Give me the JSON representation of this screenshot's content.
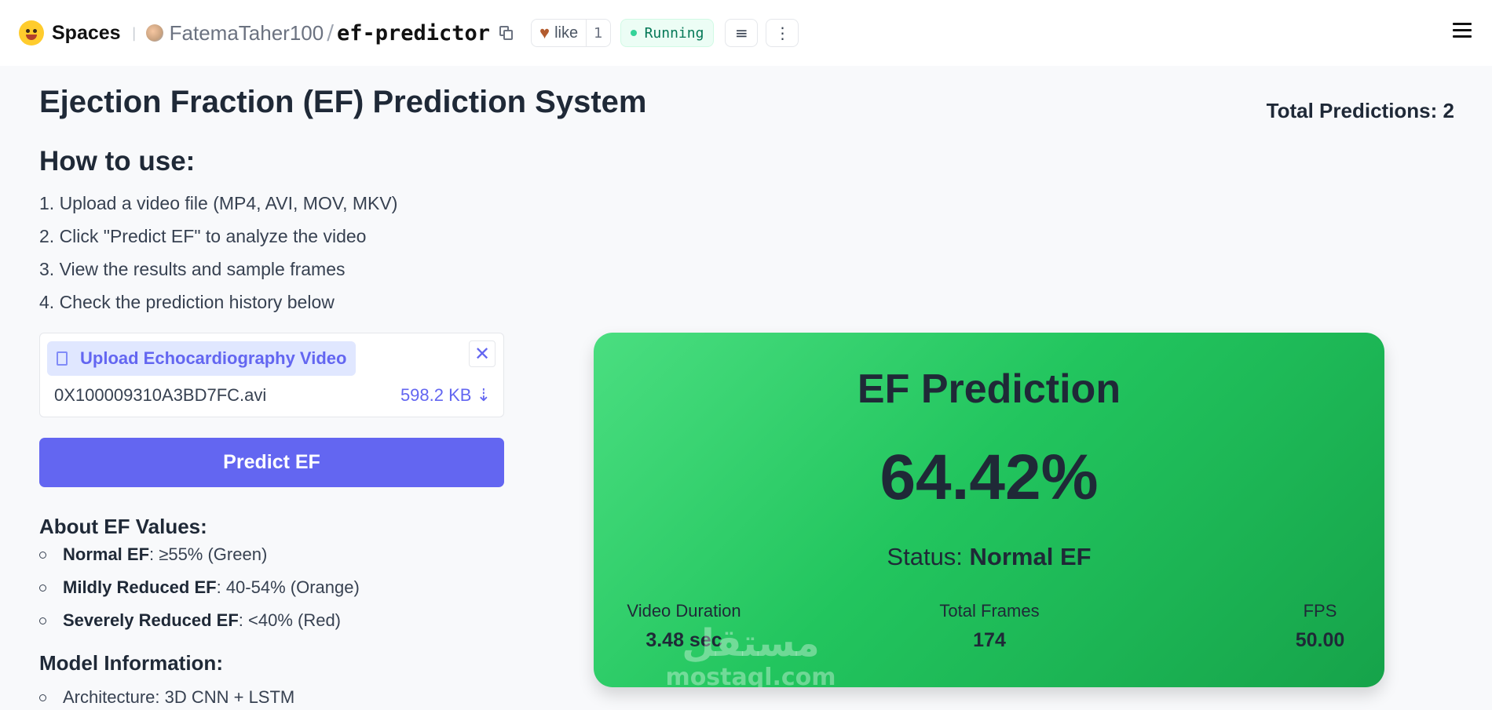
{
  "topbar": {
    "spaces_label": "Spaces",
    "owner": "FatemaTaher100",
    "separator": "/",
    "repo": "ef-predictor",
    "like_label": "like",
    "like_count": "1",
    "status": "Running"
  },
  "page": {
    "title": "Ejection Fraction (EF) Prediction System",
    "total_predictions": "Total Predictions: 2"
  },
  "how_to": {
    "heading": "How to use:",
    "steps": [
      "1. Upload a video file (MP4, AVI, MOV, MKV)",
      "2. Click \"Predict EF\" to analyze the video",
      "3. View the results and sample frames",
      "4. Check the prediction history below"
    ]
  },
  "upload": {
    "label": "Upload Echocardiography Video",
    "file_name": "0X100009310A3BD7FC.avi",
    "file_size": "598.2 KB ⇣"
  },
  "predict_button": "Predict EF",
  "about": {
    "heading": "About EF Values:",
    "items": [
      {
        "bold": "Normal EF",
        "text": ": ≥55% (Green)"
      },
      {
        "bold": "Mildly Reduced EF",
        "text": ": 40-54% (Orange)"
      },
      {
        "bold": "Severely Reduced EF",
        "text": ": <40% (Red)"
      }
    ]
  },
  "model": {
    "heading": "Model Information:",
    "items": [
      "Architecture: 3D CNN + LSTM"
    ]
  },
  "result": {
    "title": "EF Prediction",
    "value": "64.42%",
    "status_label": "Status: ",
    "status_value": "Normal EF",
    "stats": [
      {
        "label": "Video Duration",
        "value": "3.48 sec"
      },
      {
        "label": "Total Frames",
        "value": "174"
      },
      {
        "label": "FPS",
        "value": "50.00"
      }
    ],
    "color": "#22c55e"
  },
  "watermark": {
    "arabic": "مستقل",
    "latin": "mostaql.com"
  }
}
